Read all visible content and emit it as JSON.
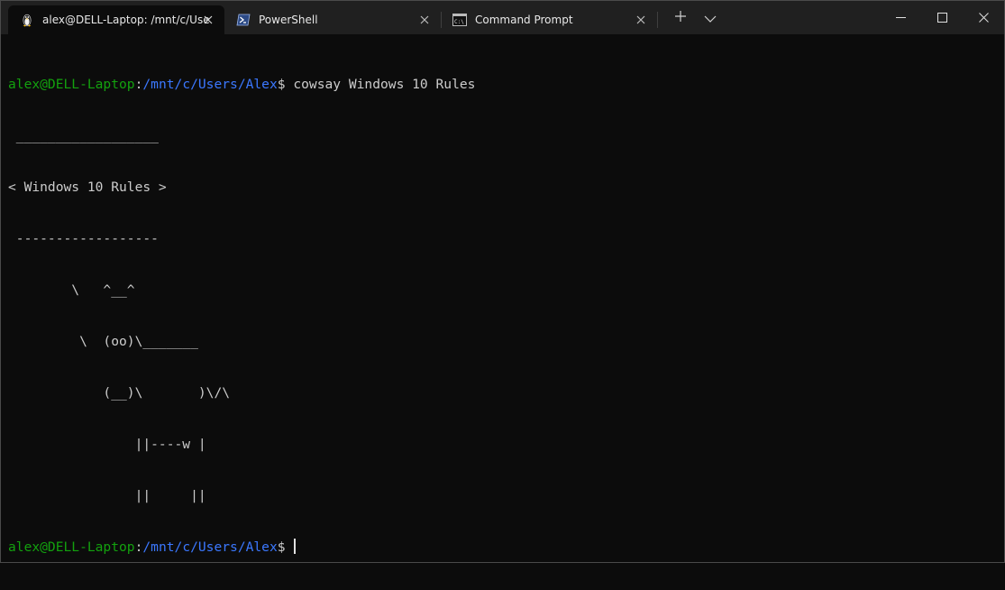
{
  "window": {
    "tabs": [
      {
        "title": "alex@DELL-Laptop: /mnt/c/Use",
        "icon": "linux-penguin-icon",
        "active": true
      },
      {
        "title": "PowerShell",
        "icon": "powershell-icon",
        "active": false
      },
      {
        "title": "Command Prompt",
        "icon": "cmd-icon",
        "active": false
      }
    ],
    "new_tab_icon": "plus-icon",
    "dropdown_icon": "chevron-down-icon",
    "controls": [
      "minimize-icon",
      "maximize-icon",
      "close-icon"
    ]
  },
  "colors": {
    "background": "#0c0c0c",
    "titlebar": "#202020",
    "prompt_user": "#13a10e",
    "prompt_path": "#3b78ff",
    "text": "#cccccc"
  },
  "terminal": {
    "prompt_user": "alex@DELL-Laptop",
    "prompt_colon": ":",
    "prompt_path": "/mnt/c/Users/Alex",
    "prompt_symbol": "$ ",
    "command": "cowsay Windows 10 Rules",
    "output": [
      " __________________",
      "< Windows 10 Rules >",
      " ------------------",
      "        \\   ^__^",
      "         \\  (oo)\\_______",
      "            (__)\\       )\\/\\",
      "                ||----w |",
      "                ||     ||"
    ]
  }
}
